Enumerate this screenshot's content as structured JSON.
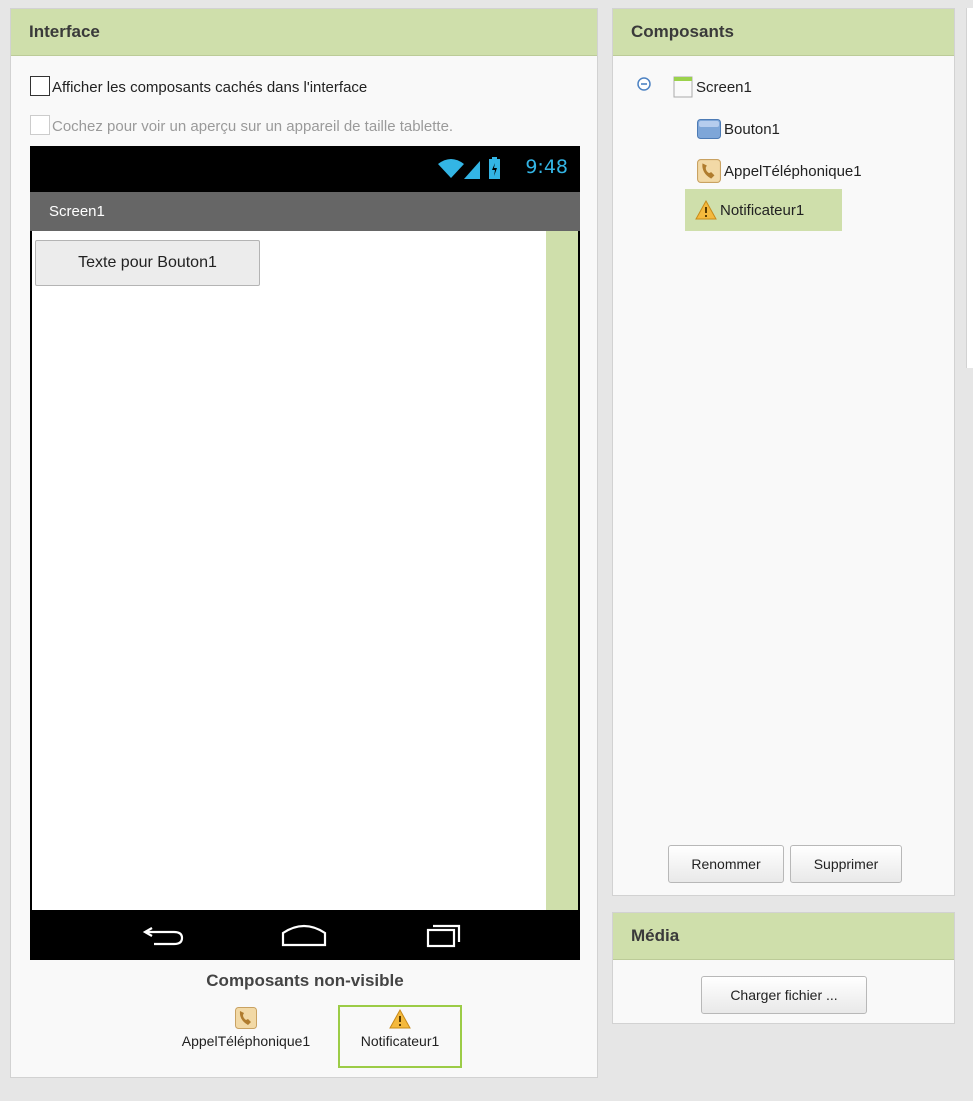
{
  "viewer": {
    "title": "Interface",
    "show_hidden_label": "Afficher les composants cachés dans l'interface",
    "tablet_preview_label": "Cochez pour voir un aperçu sur un appareil de taille tablette.",
    "phone": {
      "time": "9:48",
      "screen_title": "Screen1",
      "button_text": "Texte pour Bouton1"
    },
    "non_visible": {
      "title": "Composants non-visible",
      "items": [
        {
          "label": "AppelTéléphonique1",
          "icon": "phone-call-icon"
        },
        {
          "label": "Notificateur1",
          "icon": "warning-icon"
        }
      ]
    }
  },
  "components": {
    "title": "Composants",
    "tree": [
      {
        "label": "Screen1",
        "icon": "screen-icon"
      },
      {
        "label": "Bouton1",
        "icon": "button-icon"
      },
      {
        "label": "AppelTéléphonique1",
        "icon": "phone-call-icon"
      },
      {
        "label": "Notificateur1",
        "icon": "warning-icon",
        "selected": true
      }
    ],
    "rename_label": "Renommer",
    "delete_label": "Supprimer"
  },
  "media": {
    "title": "Média",
    "upload_label": "Charger fichier ..."
  },
  "colors": {
    "header": "#cfdfab",
    "selection": "#cfdfab",
    "clock": "#33b5e5",
    "non_visible_selection": "#9ccc47"
  }
}
